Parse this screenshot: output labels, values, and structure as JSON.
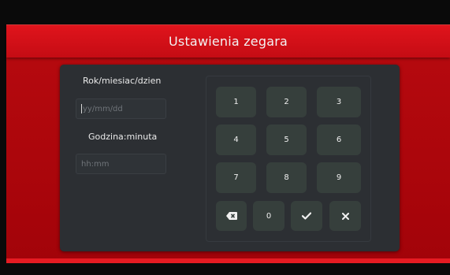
{
  "header": {
    "title": "Ustawienia zegara"
  },
  "form": {
    "date_label": "Rok/miesiac/dzien",
    "date_placeholder": "yy/mm/dd",
    "time_label": "Godzina:minuta",
    "time_placeholder": "hh:mm"
  },
  "keypad": {
    "keys": [
      "1",
      "2",
      "3",
      "4",
      "5",
      "6",
      "7",
      "8",
      "9"
    ],
    "zero": "0",
    "backspace_icon": "backspace-icon",
    "confirm_icon": "checkmark-icon",
    "clear_icon": "close-icon"
  },
  "colors": {
    "accent": "#d0101a",
    "panel": "#2c2f33",
    "key": "#363f3c"
  }
}
